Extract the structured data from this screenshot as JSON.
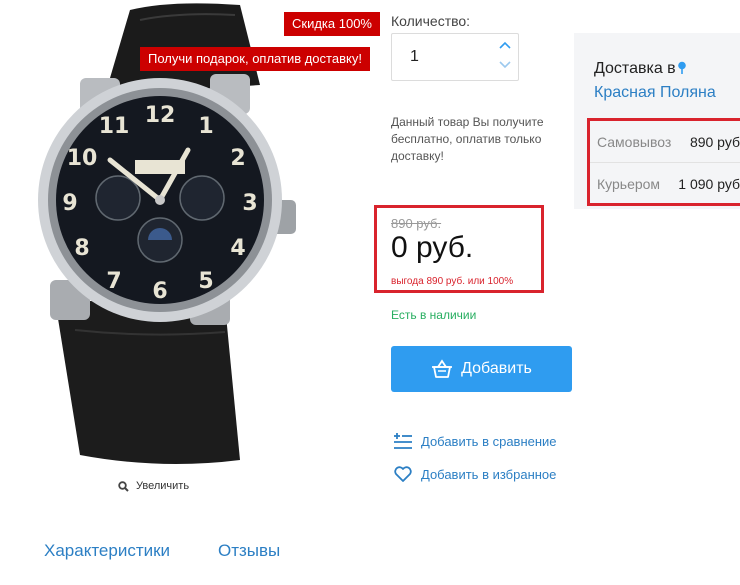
{
  "product": {
    "image_alt": "wristwatch",
    "badges": {
      "discount": "Скидка 100%",
      "gift": "Получи подарок, оплатив доставку!"
    },
    "zoom_label": "Увеличить"
  },
  "quantity": {
    "label": "Количество:",
    "value": "1"
  },
  "free_note": "Данный товар Вы получите бесплатно, оплатив только доставку!",
  "price": {
    "old": "890 руб.",
    "new": "0 руб.",
    "saving": "выгода 890 руб. или 100%"
  },
  "stock": "Есть в наличии",
  "actions": {
    "add_label": "Добавить",
    "compare_label": "Добавить в сравнение",
    "favorite_label": "Добавить в избранное"
  },
  "delivery": {
    "title": "Доставка в",
    "city": "Красная Поляна",
    "options": [
      {
        "name": "Самовывоз",
        "price": "890 руб"
      },
      {
        "name": "Курьером",
        "price": "1 090 руб"
      }
    ]
  },
  "tabs": [
    "Характеристики",
    "Отзывы"
  ],
  "colors": {
    "accent": "#2f9cf0",
    "badge": "#cc0000",
    "highlight": "#d9232d",
    "in_stock": "#27ae60",
    "link": "#2c7fc4"
  }
}
